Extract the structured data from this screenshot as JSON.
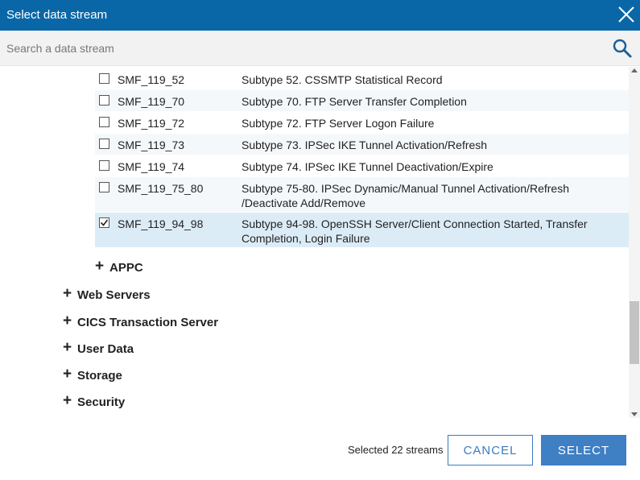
{
  "dialog": {
    "title": "Select data stream",
    "close_icon": "close-icon"
  },
  "search": {
    "placeholder": "Search a data stream",
    "value": "",
    "icon": "search-icon"
  },
  "streams": [
    {
      "code": "SMF_119_52",
      "description": "Subtype 52. CSSMTP Statistical Record",
      "checked": false
    },
    {
      "code": "SMF_119_70",
      "description": "Subtype 70. FTP Server Transfer Completion",
      "checked": false
    },
    {
      "code": "SMF_119_72",
      "description": "Subtype 72. FTP Server Logon Failure",
      "checked": false
    },
    {
      "code": "SMF_119_73",
      "description": "Subtype 73. IPSec IKE Tunnel Activation/Refresh",
      "checked": false
    },
    {
      "code": "SMF_119_74",
      "description": "Subtype 74. IPSec IKE Tunnel Deactivation/Expire",
      "checked": false
    },
    {
      "code": "SMF_119_75_80",
      "description": "Subtype 75-80. IPSec Dynamic/Manual Tunnel Activation/Refresh /Deactivate Add/Remove",
      "checked": false
    },
    {
      "code": "SMF_119_94_98",
      "description": "Subtype 94-98. OpenSSH Server/Client Connection Started, Transfer Completion, Login Failure",
      "checked": true
    }
  ],
  "groups": [
    {
      "label": "APPC",
      "expand_symbol": "+"
    },
    {
      "label": "Web Servers",
      "expand_symbol": "+"
    },
    {
      "label": "CICS Transaction Server",
      "expand_symbol": "+"
    },
    {
      "label": "User Data",
      "expand_symbol": "+"
    },
    {
      "label": "Storage",
      "expand_symbol": "+"
    },
    {
      "label": "Security",
      "expand_symbol": "+"
    }
  ],
  "footer": {
    "status": "Selected 22 streams",
    "cancel_label": "CANCEL",
    "select_label": "SELECT"
  },
  "colors": {
    "header": "#0a67a7",
    "accent": "#3f7fc3",
    "selected_row": "#dcecf7"
  }
}
